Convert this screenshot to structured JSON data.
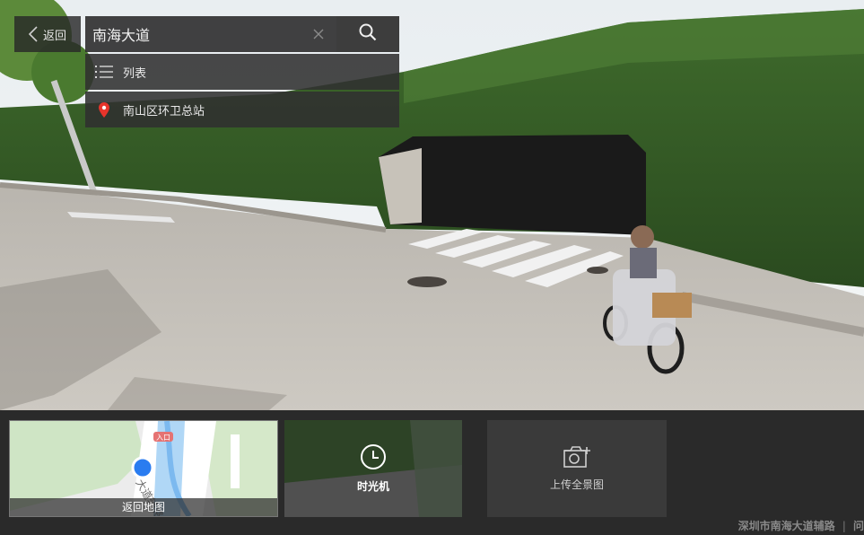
{
  "nav": {
    "back_label": "返回"
  },
  "search": {
    "value": "南海大道",
    "placeholder": ""
  },
  "dropdown": {
    "items": [
      {
        "label": "列表",
        "icon": "list-icon"
      },
      {
        "label": "南山区环卫总站",
        "icon": "location-pin-icon"
      }
    ]
  },
  "bottom": {
    "map_label": "返回地图",
    "map_badge": "入口",
    "map_road": "大道辅路",
    "timemachine_label": "时光机",
    "upload_label": "上传全景图"
  },
  "footer": {
    "address": "深圳市南海大道辅路",
    "extra": "问"
  },
  "colors": {
    "pin": "#e8342b",
    "map_marker": "#2a7cf0",
    "map_green": "#cfe5c5"
  }
}
